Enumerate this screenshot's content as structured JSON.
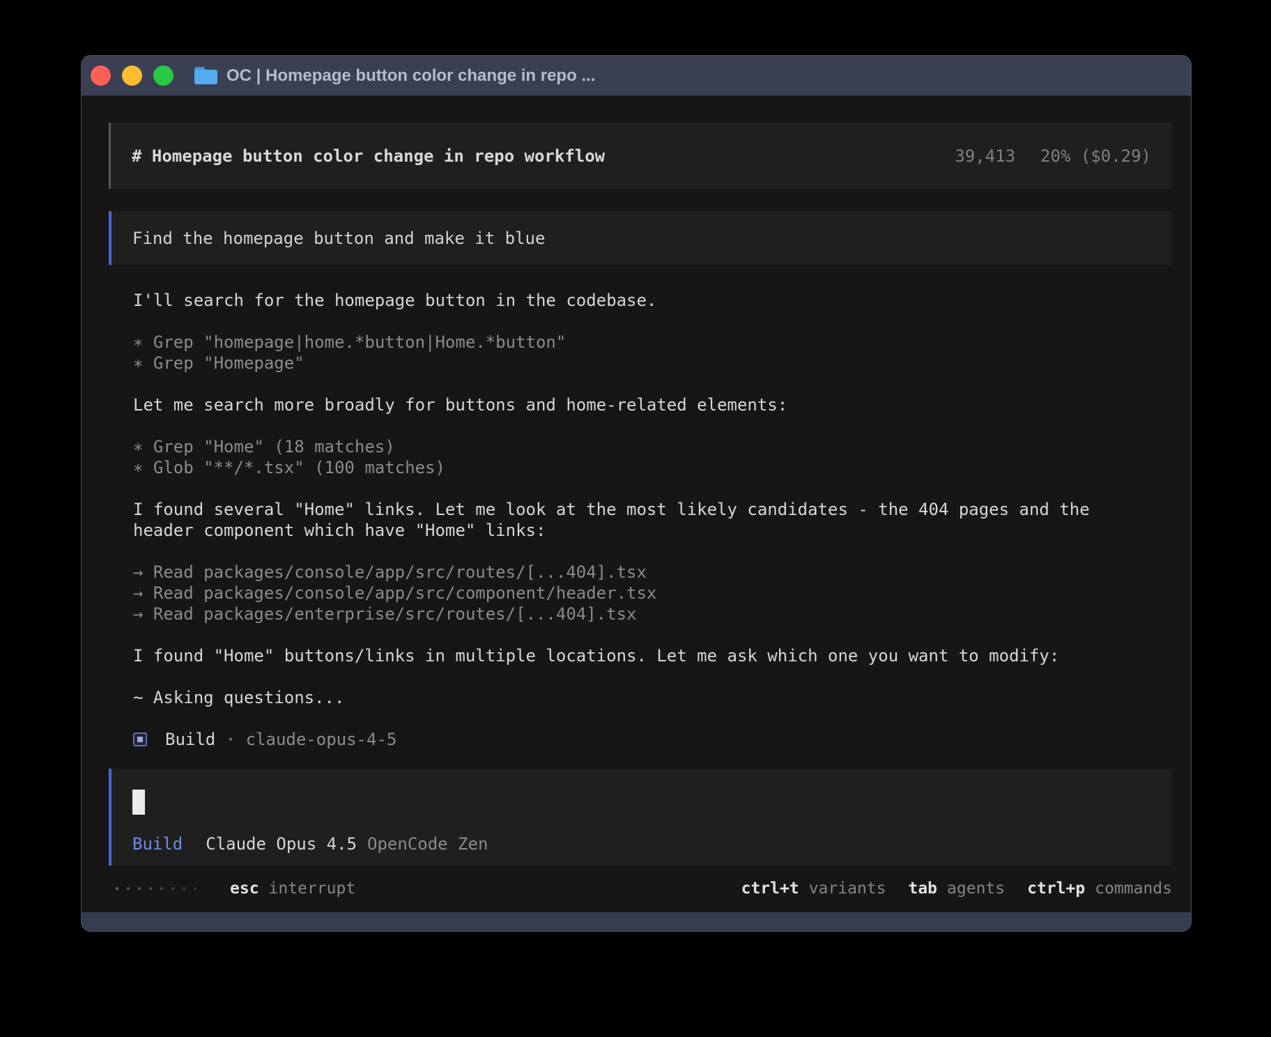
{
  "window": {
    "title": "OC | Homepage button color change in repo ..."
  },
  "colors": {
    "titlebar": "#3a3f53",
    "terminal_bg": "#161616",
    "block_bg": "#1f1f1f",
    "accent_blue_border": "#4a67d4",
    "accent_blue_text": "#6e8ee3",
    "bright_text": "#d6d6d8",
    "dim_text": "#8b8b8e",
    "traffic_red": "#ff5f57",
    "traffic_yellow": "#febc2e",
    "traffic_green": "#28c840",
    "folder_blue": "#54abef"
  },
  "header": {
    "title": "# Homepage button color change in repo workflow",
    "tokens": "39,413",
    "usage": "20% ($0.29)"
  },
  "user_message": {
    "text": "Find the homepage button and make it blue"
  },
  "transcript": {
    "lines": [
      {
        "segments": [
          {
            "style": "bright",
            "text": "I'll search for the homepage button in the codebase."
          }
        ]
      },
      {
        "segments": []
      },
      {
        "segments": [
          {
            "style": "dim",
            "text": "∗ Grep \"homepage|home.*button|Home.*button\""
          }
        ]
      },
      {
        "segments": [
          {
            "style": "dim",
            "text": "∗ Grep \"Homepage\""
          }
        ]
      },
      {
        "segments": []
      },
      {
        "segments": [
          {
            "style": "bright",
            "text": "Let me search more broadly for buttons and home-related elements:"
          }
        ]
      },
      {
        "segments": []
      },
      {
        "segments": [
          {
            "style": "dim",
            "text": "∗ Grep \"Home\" (18 matches)"
          }
        ]
      },
      {
        "segments": [
          {
            "style": "dim",
            "text": "∗ Glob \"**/*.tsx\" (100 matches)"
          }
        ]
      },
      {
        "segments": []
      },
      {
        "segments": [
          {
            "style": "bright",
            "text": "I found several \"Home\" links. Let me look at the most likely candidates - the 404 pages and the"
          }
        ]
      },
      {
        "segments": [
          {
            "style": "bright",
            "text": "header component which have \"Home\" links:"
          }
        ]
      },
      {
        "segments": []
      },
      {
        "segments": [
          {
            "style": "dim",
            "text": "→ Read packages/console/app/src/routes/[...404].tsx"
          }
        ]
      },
      {
        "segments": [
          {
            "style": "dim",
            "text": "→ Read packages/console/app/src/component/header.tsx"
          }
        ]
      },
      {
        "segments": [
          {
            "style": "dim",
            "text": "→ Read packages/enterprise/src/routes/[...404].tsx"
          }
        ]
      },
      {
        "segments": []
      },
      {
        "segments": [
          {
            "style": "bright",
            "text": "I found \"Home\" buttons/links in multiple locations. Let me ask which one you want to modify:"
          }
        ]
      },
      {
        "segments": []
      },
      {
        "segments": [
          {
            "style": "bright",
            "text": "~ Asking questions..."
          }
        ]
      },
      {
        "segments": []
      },
      {
        "segments": [
          {
            "style": "icon"
          },
          {
            "style": "bright",
            "text": "Build"
          },
          {
            "style": "dim",
            "text": " · claude-opus-4-5"
          }
        ]
      }
    ]
  },
  "input": {
    "agent": "Build",
    "model": "Claude Opus 4.5",
    "provider": "OpenCode Zen"
  },
  "statusbar": {
    "spinner_dot_count": 8,
    "left_hint": {
      "key": "esc",
      "label": "interrupt"
    },
    "hints": [
      {
        "key": "ctrl+t",
        "label": "variants"
      },
      {
        "key": "tab",
        "label": "agents"
      },
      {
        "key": "ctrl+p",
        "label": "commands"
      }
    ]
  }
}
